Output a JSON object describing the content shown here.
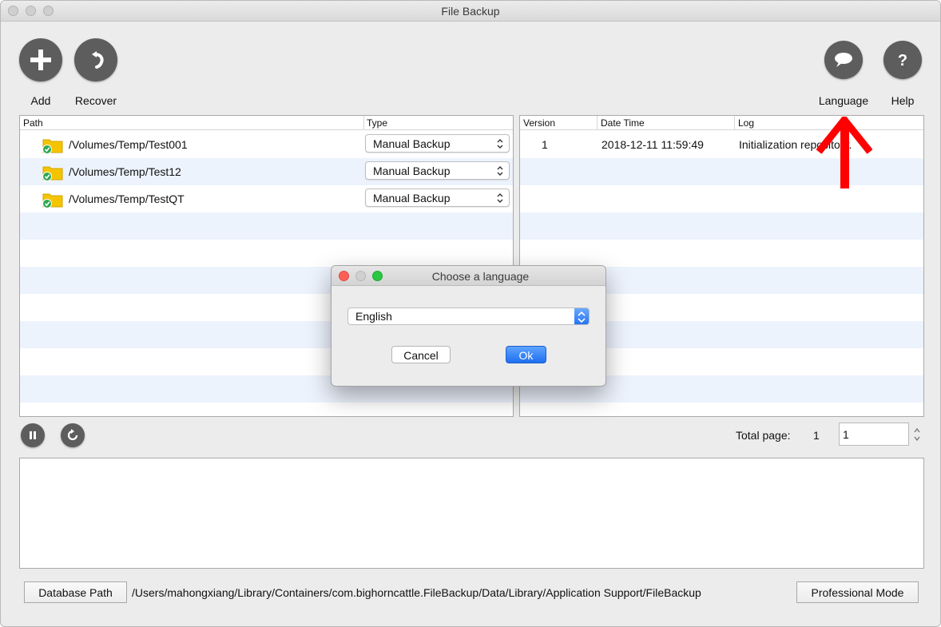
{
  "window": {
    "title": "File Backup"
  },
  "toolbar": {
    "add_label": "Add",
    "recover_label": "Recover",
    "language_label": "Language",
    "help_label": "Help"
  },
  "backup_table": {
    "columns": [
      "Path",
      "Type"
    ],
    "rows": [
      {
        "path": "/Volumes/Temp/Test001",
        "type": "Manual Backup"
      },
      {
        "path": "/Volumes/Temp/Test12",
        "type": "Manual Backup"
      },
      {
        "path": "/Volumes/Temp/TestQT",
        "type": "Manual Backup"
      }
    ]
  },
  "version_table": {
    "columns": [
      "Version",
      "Date Time",
      "Log"
    ],
    "rows": [
      {
        "version": "1",
        "datetime": "2018-12-11 11:59:49",
        "log": "Initialization repository."
      }
    ]
  },
  "pagination": {
    "total_label": "Total page:",
    "total_value": "1",
    "current_page": "1"
  },
  "footer": {
    "database_path_label": "Database Path",
    "database_path": "/Users/mahongxiang/Library/Containers/com.bighorncattle.FileBackup/Data/Library/Application Support/FileBackup",
    "professional_mode_label": "Professional Mode"
  },
  "dialog": {
    "title": "Choose a language",
    "selected_language": "English",
    "cancel_label": "Cancel",
    "ok_label": "Ok"
  },
  "colors": {
    "accent": "#1f6ff0",
    "row_alt": "#edf3fd",
    "icon_button": "#5d5d5d",
    "annotation_arrow": "#ff0000",
    "folder": "#f5c400",
    "check": "#2fa84f"
  },
  "icons": {
    "add": "plus-icon",
    "recover": "undo-arrow-icon",
    "language": "speech-bubble-icon",
    "help": "question-mark-icon",
    "pause": "pause-icon",
    "refresh": "refresh-icon",
    "folder": "folder-check-icon",
    "annotation": "arrow-up-icon"
  }
}
